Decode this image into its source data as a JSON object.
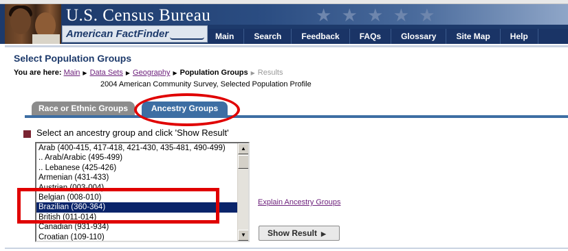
{
  "header": {
    "site_title": "U.S. Census Bureau",
    "app_name": "American FactFinder",
    "nav": [
      "Main",
      "Search",
      "Feedback",
      "FAQs",
      "Glossary",
      "Site Map",
      "Help"
    ]
  },
  "page": {
    "title": "Select Population Groups",
    "breadcrumb_label": "You are here:",
    "breadcrumb": [
      {
        "text": "Main",
        "type": "link"
      },
      {
        "text": "Data Sets",
        "type": "link"
      },
      {
        "text": "Geography",
        "type": "link"
      },
      {
        "text": "Population Groups",
        "type": "current"
      },
      {
        "text": "Results",
        "type": "inactive"
      }
    ],
    "survey": "2004 American Community Survey, Selected Population Profile"
  },
  "tabs": [
    {
      "label": "Race or Ethnic Groups",
      "active": false
    },
    {
      "label": "Ancestry Groups",
      "active": true
    }
  ],
  "content": {
    "instruction": "Select an ancestry group and click 'Show Result'",
    "list_items": [
      "Arab (400-415, 417-418, 421-430, 435-481, 490-499)",
      ".. Arab/Arabic (495-499)",
      ".. Lebanese (425-426)",
      "Armenian (431-433)",
      "Austrian (003-004)",
      "Belgian (008-010)",
      "Brazilian (360-364)",
      "British (011-014)",
      "Canadian (931-934)",
      "Croatian (109-110)"
    ],
    "selected_item": "Brazilian (360-364)",
    "explain_link": "Explain Ancestry Groups",
    "show_button": "Show Result",
    "scroll_up_glyph": "▲",
    "scroll_down_glyph": "▼",
    "arrow_glyph": "▶"
  },
  "colors": {
    "header_blue": "#1d3a6b",
    "tab_active": "#3d6ea3",
    "tab_inactive": "#8c8c8c",
    "highlight_red": "#e00000",
    "selection": "#0a246a"
  }
}
